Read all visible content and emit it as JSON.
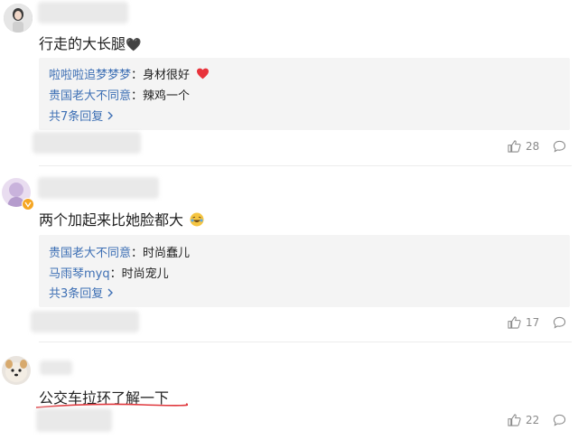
{
  "comments": [
    {
      "text": "行走的大长腿",
      "emoji": "🖤",
      "replies": [
        {
          "user": "啦啦啦追梦梦梦",
          "sep": "：",
          "text": "身材很好"
        },
        {
          "user": "贵国老大不同意",
          "sep": "：",
          "text": "辣鸡一个"
        }
      ],
      "more_label": "共7条回复",
      "likes": "28"
    },
    {
      "text": "两个加起来比她脸都大",
      "emoji": "😂",
      "replies": [
        {
          "user": "贵国老大不同意",
          "sep": "：",
          "text": "时尚蠢儿"
        },
        {
          "user": "马雨琴myq",
          "sep": "：",
          "text": "时尚宠儿"
        }
      ],
      "more_label": "共3条回复",
      "likes": "17"
    },
    {
      "text": "公交车拉环了解一下",
      "likes": "22"
    }
  ],
  "colors": {
    "link": "#3d6fb4",
    "heart": "#e8333b",
    "badge": "#f5a623",
    "underline": "#e0393e"
  },
  "icons": [
    "thumb-up-icon",
    "comment-icon",
    "heart-icon",
    "verified-badge-icon",
    "chevron-right-icon"
  ]
}
